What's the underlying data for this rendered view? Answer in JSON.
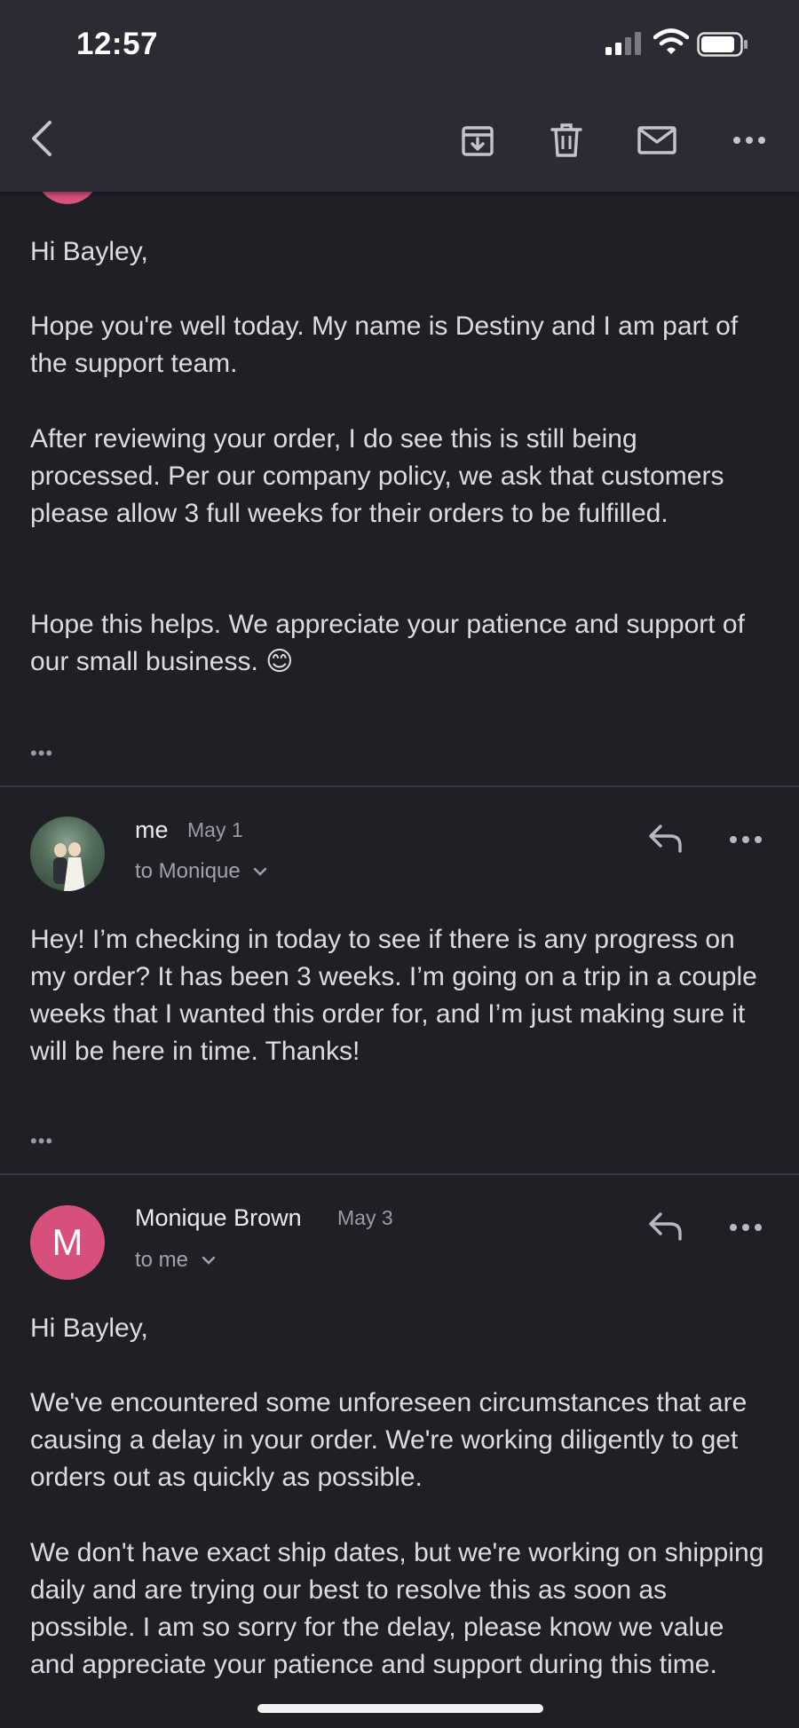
{
  "status_bar": {
    "time": "12:57"
  },
  "toolbar": {
    "back_icon": "chevron-left-icon",
    "archive_icon": "archive-icon",
    "delete_icon": "trash-icon",
    "mark_unread_icon": "mail-icon",
    "more_icon": "more-horizontal-icon"
  },
  "message1": {
    "greeting": "Hi Bayley,",
    "paragraphs": [
      "Hope you're well today. My name is Destiny and I am part of the support team.",
      "After reviewing your order, I do see this is still being processed. Per our company policy, we ask that customers please allow 3 full weeks for their orders to be fulfilled.",
      "Hope this helps. We appreciate your patience and support of our small business. 😊"
    ],
    "more": "•••"
  },
  "message2": {
    "sender": "me",
    "date": "May 1",
    "recipient": "to Monique",
    "body": "Hey! I’m checking in today to see if there is any progress on my order? It has been 3 weeks. I’m going on a trip in a couple weeks that I wanted this order for, and I’m just making sure it will be here in time. Thanks!",
    "more": "•••"
  },
  "message3": {
    "avatar_letter": "M",
    "sender": "Monique Brown",
    "date": "May 3",
    "recipient": "to me",
    "greeting": "Hi Bayley,",
    "paragraphs": [
      "We've encountered some unforeseen circumstances that are causing a delay in your order. We're working diligently to get orders out as quickly as possible.",
      "We don't have exact ship dates, but we're working on shipping daily and are trying our best to resolve this as soon as possible. I am so sorry for the delay, please know we value and appreciate your patience and support during this time."
    ]
  },
  "colors": {
    "background": "#1f1f26",
    "header": "#2b2c33",
    "avatar_pink": "#d6507b"
  }
}
